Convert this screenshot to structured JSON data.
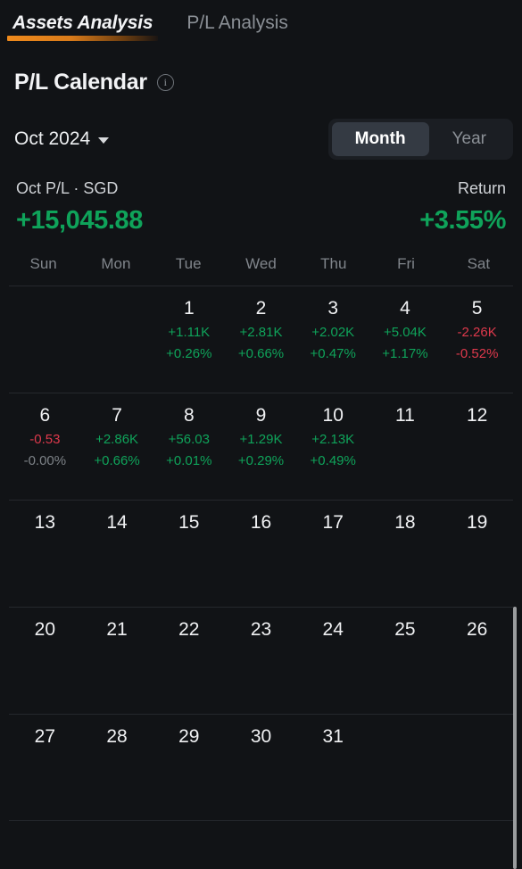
{
  "tabs": [
    {
      "label": "Assets Analysis",
      "active": true
    },
    {
      "label": "P/L Analysis",
      "active": false
    }
  ],
  "header": {
    "page_title": "P/L Calendar",
    "info_icon": "info-circle-icon"
  },
  "controls": {
    "month_selector": "Oct 2024",
    "caret_icon": "chevron-down-icon",
    "range_toggle": {
      "options": [
        "Month",
        "Year"
      ],
      "selected": "Month"
    }
  },
  "summary": {
    "pl_label": "Oct P/L · SGD",
    "pl_value": "+15,045.88",
    "pl_sign": "positive",
    "return_label": "Return",
    "return_value": "+3.55%",
    "return_sign": "positive"
  },
  "colors": {
    "background": "#111316",
    "positive": "#0fa35a",
    "negative": "#de394c",
    "neutral": "#7d8287",
    "accent": "#ef8a1c",
    "divider": "#25282d",
    "segment_track": "#1b1e23",
    "segment_active": "#343a43"
  },
  "calendar": {
    "weekday_headers": [
      "Sun",
      "Mon",
      "Tue",
      "Wed",
      "Thu",
      "Fri",
      "Sat"
    ],
    "weeks": [
      [
        {
          "day": "",
          "amount": "",
          "percent": "",
          "amount_sign": "",
          "percent_sign": ""
        },
        {
          "day": "",
          "amount": "",
          "percent": "",
          "amount_sign": "",
          "percent_sign": ""
        },
        {
          "day": "1",
          "amount": "+1.11K",
          "percent": "+0.26%",
          "amount_sign": "positive",
          "percent_sign": "positive"
        },
        {
          "day": "2",
          "amount": "+2.81K",
          "percent": "+0.66%",
          "amount_sign": "positive",
          "percent_sign": "positive"
        },
        {
          "day": "3",
          "amount": "+2.02K",
          "percent": "+0.47%",
          "amount_sign": "positive",
          "percent_sign": "positive"
        },
        {
          "day": "4",
          "amount": "+5.04K",
          "percent": "+1.17%",
          "amount_sign": "positive",
          "percent_sign": "positive"
        },
        {
          "day": "5",
          "amount": "-2.26K",
          "percent": "-0.52%",
          "amount_sign": "negative",
          "percent_sign": "negative"
        }
      ],
      [
        {
          "day": "6",
          "amount": "-0.53",
          "percent": "-0.00%",
          "amount_sign": "negative",
          "percent_sign": "neutral"
        },
        {
          "day": "7",
          "amount": "+2.86K",
          "percent": "+0.66%",
          "amount_sign": "positive",
          "percent_sign": "positive"
        },
        {
          "day": "8",
          "amount": "+56.03",
          "percent": "+0.01%",
          "amount_sign": "positive",
          "percent_sign": "positive"
        },
        {
          "day": "9",
          "amount": "+1.29K",
          "percent": "+0.29%",
          "amount_sign": "positive",
          "percent_sign": "positive"
        },
        {
          "day": "10",
          "amount": "+2.13K",
          "percent": "+0.49%",
          "amount_sign": "positive",
          "percent_sign": "positive"
        },
        {
          "day": "11",
          "amount": "",
          "percent": "",
          "amount_sign": "",
          "percent_sign": ""
        },
        {
          "day": "12",
          "amount": "",
          "percent": "",
          "amount_sign": "",
          "percent_sign": ""
        }
      ],
      [
        {
          "day": "13",
          "amount": "",
          "percent": "",
          "amount_sign": "",
          "percent_sign": ""
        },
        {
          "day": "14",
          "amount": "",
          "percent": "",
          "amount_sign": "",
          "percent_sign": ""
        },
        {
          "day": "15",
          "amount": "",
          "percent": "",
          "amount_sign": "",
          "percent_sign": ""
        },
        {
          "day": "16",
          "amount": "",
          "percent": "",
          "amount_sign": "",
          "percent_sign": ""
        },
        {
          "day": "17",
          "amount": "",
          "percent": "",
          "amount_sign": "",
          "percent_sign": ""
        },
        {
          "day": "18",
          "amount": "",
          "percent": "",
          "amount_sign": "",
          "percent_sign": ""
        },
        {
          "day": "19",
          "amount": "",
          "percent": "",
          "amount_sign": "",
          "percent_sign": ""
        }
      ],
      [
        {
          "day": "20",
          "amount": "",
          "percent": "",
          "amount_sign": "",
          "percent_sign": ""
        },
        {
          "day": "21",
          "amount": "",
          "percent": "",
          "amount_sign": "",
          "percent_sign": ""
        },
        {
          "day": "22",
          "amount": "",
          "percent": "",
          "amount_sign": "",
          "percent_sign": ""
        },
        {
          "day": "23",
          "amount": "",
          "percent": "",
          "amount_sign": "",
          "percent_sign": ""
        },
        {
          "day": "24",
          "amount": "",
          "percent": "",
          "amount_sign": "",
          "percent_sign": ""
        },
        {
          "day": "25",
          "amount": "",
          "percent": "",
          "amount_sign": "",
          "percent_sign": ""
        },
        {
          "day": "26",
          "amount": "",
          "percent": "",
          "amount_sign": "",
          "percent_sign": ""
        }
      ],
      [
        {
          "day": "27",
          "amount": "",
          "percent": "",
          "amount_sign": "",
          "percent_sign": ""
        },
        {
          "day": "28",
          "amount": "",
          "percent": "",
          "amount_sign": "",
          "percent_sign": ""
        },
        {
          "day": "29",
          "amount": "",
          "percent": "",
          "amount_sign": "",
          "percent_sign": ""
        },
        {
          "day": "30",
          "amount": "",
          "percent": "",
          "amount_sign": "",
          "percent_sign": ""
        },
        {
          "day": "31",
          "amount": "",
          "percent": "",
          "amount_sign": "",
          "percent_sign": ""
        },
        {
          "day": "",
          "amount": "",
          "percent": "",
          "amount_sign": "",
          "percent_sign": ""
        },
        {
          "day": "",
          "amount": "",
          "percent": "",
          "amount_sign": "",
          "percent_sign": ""
        }
      ]
    ]
  },
  "scrollbar": {
    "name": "vertical-scrollbar"
  }
}
